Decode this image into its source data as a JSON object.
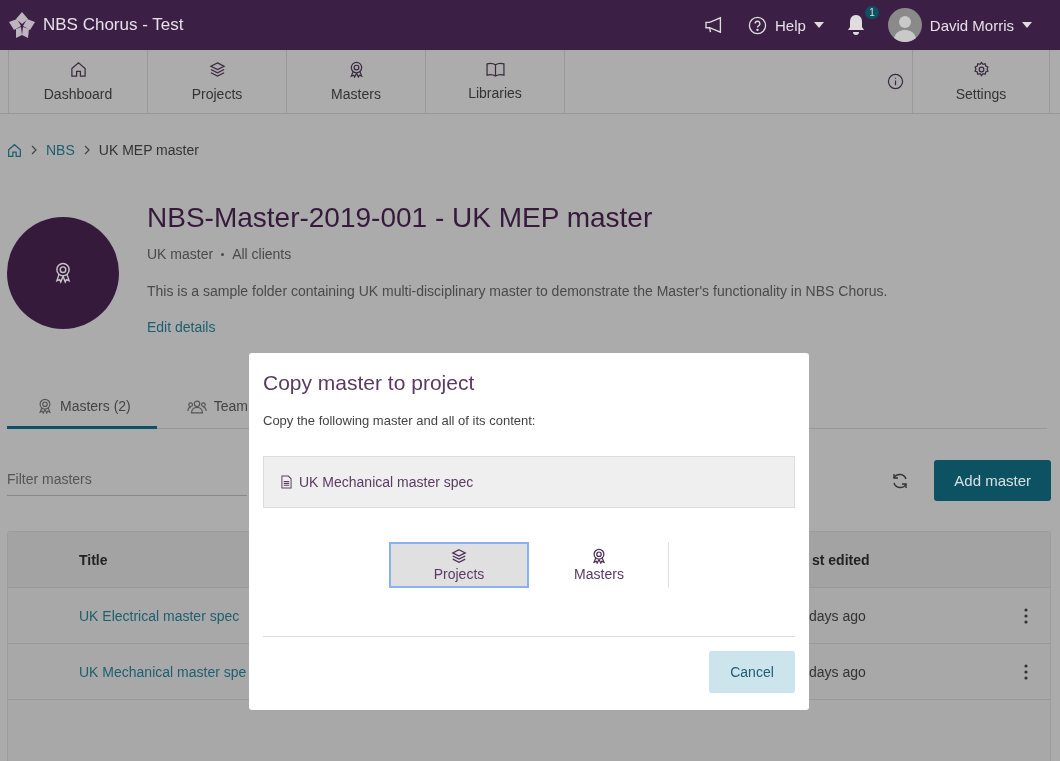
{
  "app": {
    "title": "NBS Chorus - Test",
    "help": "Help",
    "notification_count": "1",
    "user": "David Morris"
  },
  "nav": [
    {
      "label": "Dashboard",
      "selected": false
    },
    {
      "label": "Projects",
      "selected": false
    },
    {
      "label": "Masters",
      "selected": false
    },
    {
      "label": "Libraries",
      "selected": false
    }
  ],
  "settings": "Settings",
  "breadcrumb": [
    "NBS",
    "UK MEP master"
  ],
  "header": {
    "title": "NBS-Master-2019-001 - UK MEP master",
    "type": "UK master",
    "clients": "All clients",
    "description": "This is a sample folder containing UK multi-disciplinary master to demonstrate the Master's functionality in NBS Chorus.",
    "edit_link": "Edit details"
  },
  "tabs": [
    {
      "label": "Masters (2)",
      "selected": true
    },
    {
      "label": "Team",
      "selected": false
    }
  ],
  "filter": {
    "placeholder": "Filter masters"
  },
  "add_button": "Add master",
  "table": {
    "columns": [
      "Title",
      "st edited"
    ],
    "rows": [
      {
        "title": "UK Electrical master spec",
        "edited": "days ago"
      },
      {
        "title": "UK Mechanical master spe",
        "edited": "days ago"
      }
    ]
  },
  "dialog": {
    "title": "Copy master to project",
    "prompt": "Copy the following master and all of its content:",
    "item": "UK Mechanical master spec",
    "options": [
      {
        "label": "Projects",
        "selected": true
      },
      {
        "label": "Masters",
        "selected": false
      }
    ],
    "cancel": "Cancel"
  }
}
